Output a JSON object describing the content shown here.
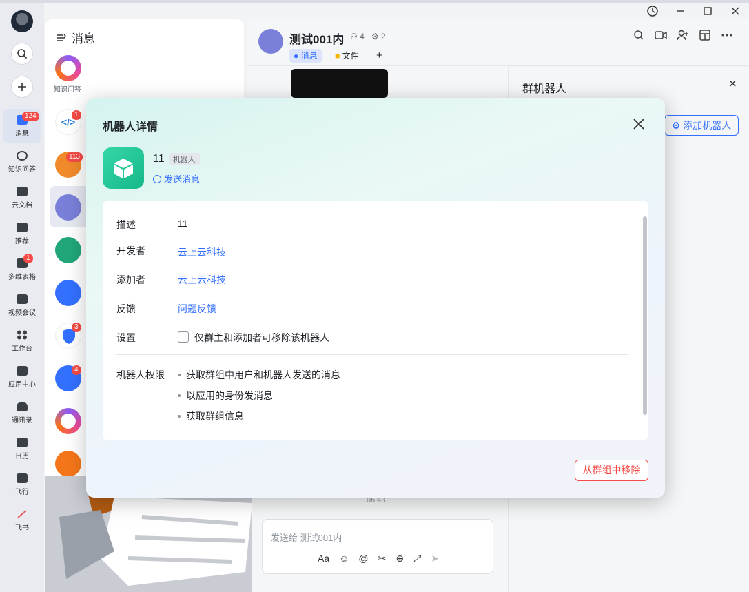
{
  "rail": {
    "items": [
      {
        "label": "消息",
        "badge": "124"
      },
      {
        "label": "知识问答",
        "badge": ""
      },
      {
        "label": "云文档",
        "badge": ""
      },
      {
        "label": "推荐",
        "badge": ""
      },
      {
        "label": "多维表格",
        "badge": "1"
      },
      {
        "label": "视频会议",
        "badge": ""
      },
      {
        "label": "工作台",
        "badge": ""
      },
      {
        "label": "应用中心",
        "badge": ""
      },
      {
        "label": "通讯录",
        "badge": ""
      },
      {
        "label": "日历",
        "badge": ""
      },
      {
        "label": "飞行",
        "badge": ""
      },
      {
        "label": "飞书",
        "badge": ""
      }
    ]
  },
  "list": {
    "title": "消息",
    "first_label": "知识问答",
    "badges": [
      "1",
      "113",
      "3",
      "4"
    ]
  },
  "chat": {
    "title": "测试001内",
    "members": "4",
    "bots": "2",
    "tabs": [
      "消息",
      "文件",
      "+"
    ],
    "timestamp": "06:43",
    "compose_placeholder": "发送给 测试001内",
    "tools": [
      "Aa",
      "☺",
      "@",
      "✂",
      "⊕",
      "⤢",
      "➤"
    ]
  },
  "right_panel": {
    "title": "群机器人",
    "add_button": "添加机器人",
    "close": "×"
  },
  "modal": {
    "title": "机器人详情",
    "bot_name": "11",
    "bot_tag": "机器人",
    "send_message": "发送消息",
    "fields": {
      "description_label": "描述",
      "description_value": "11",
      "developer_label": "开发者",
      "developer_value": "云上云科技",
      "adder_label": "添加者",
      "adder_value": "云上云科技",
      "feedback_label": "反馈",
      "feedback_value": "问题反馈",
      "settings_label": "设置",
      "settings_value": "仅群主和添加者可移除该机器人"
    },
    "permissions_label": "机器人权限",
    "permissions": [
      "获取群组中用户和机器人发送的消息",
      "以应用的身份发消息",
      "获取群组信息"
    ],
    "remove_button": "从群组中移除"
  },
  "colors": {
    "accent": "#3370ff",
    "danger": "#f54a45",
    "bot_green": "#16b88a"
  }
}
